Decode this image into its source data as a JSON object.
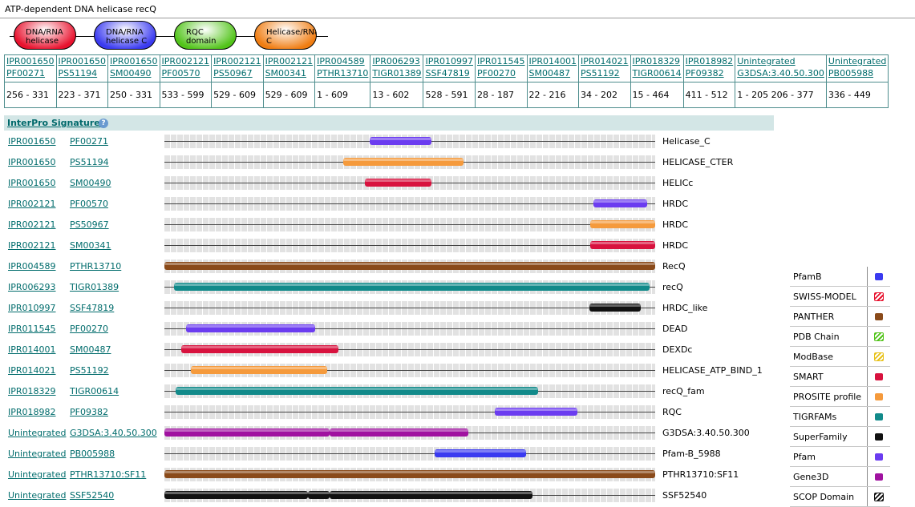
{
  "title": "ATP-dependent DNA helicase recQ",
  "domains": [
    {
      "label": "DNA/RNA helicase",
      "color": "#e8122e"
    },
    {
      "label": "DNA/RNA helicase C",
      "color": "#3a3af0"
    },
    {
      "label": "RQC domain",
      "color": "#52c41a"
    },
    {
      "label": "Helicase/RNaseD C",
      "color": "#f07d12"
    }
  ],
  "table": [
    {
      "ipr": "IPR001650",
      "acc": "PF00271",
      "pos": "256 - 331"
    },
    {
      "ipr": "IPR001650",
      "acc": "PS51194",
      "pos": "223 - 371"
    },
    {
      "ipr": "IPR001650",
      "acc": "SM00490",
      "pos": "250 - 331"
    },
    {
      "ipr": "IPR002121",
      "acc": "PF00570",
      "pos": "533 - 599"
    },
    {
      "ipr": "IPR002121",
      "acc": "PS50967",
      "pos": "529 - 609"
    },
    {
      "ipr": "IPR002121",
      "acc": "SM00341",
      "pos": "529 - 609"
    },
    {
      "ipr": "IPR004589",
      "acc": "PTHR13710",
      "pos": "1 - 609"
    },
    {
      "ipr": "IPR006293",
      "acc": "TIGR01389",
      "pos": "13 - 602"
    },
    {
      "ipr": "IPR010997",
      "acc": "SSF47819",
      "pos": "528 - 591"
    },
    {
      "ipr": "IPR011545",
      "acc": "PF00270",
      "pos": "28 - 187"
    },
    {
      "ipr": "IPR014001",
      "acc": "SM00487",
      "pos": "22 - 216"
    },
    {
      "ipr": "IPR014021",
      "acc": "PS51192",
      "pos": "34 - 202"
    },
    {
      "ipr": "IPR018329",
      "acc": "TIGR00614",
      "pos": "15 - 464"
    },
    {
      "ipr": "IPR018982",
      "acc": "PF09382",
      "pos": "411 - 512"
    },
    {
      "ipr": "Unintegrated",
      "acc": "G3DSA:3.40.50.300",
      "pos": "1 - 205 206 - 377"
    },
    {
      "ipr": "Unintegrated",
      "acc": "PB005988",
      "pos": "336 - 449"
    }
  ],
  "signatures_header": "InterPro Signatures",
  "help_icon": "?",
  "protein_length": 609,
  "signatures": [
    {
      "ipr": "IPR001650",
      "acc": "PF00271",
      "name": "Helicase_C",
      "color": "#6b3cf0",
      "segments": [
        [
          256,
          331
        ]
      ]
    },
    {
      "ipr": "IPR001650",
      "acc": "PS51194",
      "name": "HELICASE_CTER",
      "color": "#f59a3c",
      "segments": [
        [
          223,
          371
        ]
      ]
    },
    {
      "ipr": "IPR001650",
      "acc": "SM00490",
      "name": "HELICc",
      "color": "#d8123e",
      "segments": [
        [
          250,
          331
        ]
      ]
    },
    {
      "ipr": "IPR002121",
      "acc": "PF00570",
      "name": "HRDC",
      "color": "#6b3cf0",
      "segments": [
        [
          533,
          599
        ]
      ]
    },
    {
      "ipr": "IPR002121",
      "acc": "PS50967",
      "name": "HRDC",
      "color": "#f59a3c",
      "segments": [
        [
          529,
          609
        ]
      ]
    },
    {
      "ipr": "IPR002121",
      "acc": "SM00341",
      "name": "HRDC",
      "color": "#d8123e",
      "segments": [
        [
          529,
          609
        ]
      ]
    },
    {
      "ipr": "IPR004589",
      "acc": "PTHR13710",
      "name": "RecQ",
      "color": "#8a4a1a",
      "segments": [
        [
          1,
          609
        ]
      ]
    },
    {
      "ipr": "IPR006293",
      "acc": "TIGR01389",
      "name": "recQ",
      "color": "#128a8a",
      "segments": [
        [
          13,
          602
        ]
      ]
    },
    {
      "ipr": "IPR010997",
      "acc": "SSF47819",
      "name": "HRDC_like",
      "color": "#111111",
      "segments": [
        [
          528,
          591
        ]
      ]
    },
    {
      "ipr": "IPR011545",
      "acc": "PF00270",
      "name": "DEAD",
      "color": "#6b3cf0",
      "segments": [
        [
          28,
          187
        ]
      ]
    },
    {
      "ipr": "IPR014001",
      "acc": "SM00487",
      "name": "DEXDc",
      "color": "#d8123e",
      "segments": [
        [
          22,
          216
        ]
      ]
    },
    {
      "ipr": "IPR014021",
      "acc": "PS51192",
      "name": "HELICASE_ATP_BIND_1",
      "color": "#f59a3c",
      "segments": [
        [
          34,
          202
        ]
      ]
    },
    {
      "ipr": "IPR018329",
      "acc": "TIGR00614",
      "name": "recQ_fam",
      "color": "#128a8a",
      "segments": [
        [
          15,
          464
        ]
      ]
    },
    {
      "ipr": "IPR018982",
      "acc": "PF09382",
      "name": "RQC",
      "color": "#6b3cf0",
      "segments": [
        [
          411,
          512
        ]
      ]
    },
    {
      "ipr": "Unintegrated",
      "acc": "G3DSA:3.40.50.300",
      "name": "G3DSA:3.40.50.300",
      "color": "#a012a0",
      "segments": [
        [
          1,
          205
        ],
        [
          206,
          377
        ]
      ]
    },
    {
      "ipr": "Unintegrated",
      "acc": "PB005988",
      "name": "Pfam-B_5988",
      "color": "#3a3af0",
      "segments": [
        [
          336,
          449
        ]
      ]
    },
    {
      "ipr": "Unintegrated",
      "acc": "PTHR13710:SF11",
      "name": "PTHR13710:SF11",
      "color": "#8a4a1a",
      "segments": [
        [
          1,
          609
        ]
      ]
    },
    {
      "ipr": "Unintegrated",
      "acc": "SSF52540",
      "name": "SSF52540",
      "color": "#111111",
      "segments": [
        [
          1,
          178
        ],
        [
          179,
          205
        ],
        [
          206,
          457
        ]
      ]
    }
  ],
  "legend": [
    {
      "label": "PfamB",
      "color": "#3a3af0",
      "style": "solid"
    },
    {
      "label": "SWISS-MODEL",
      "color": "#e8122e",
      "style": "hatched"
    },
    {
      "label": "PANTHER",
      "color": "#8a4a1a",
      "style": "solid"
    },
    {
      "label": "PDB Chain",
      "color": "#52c41a",
      "style": "hatched"
    },
    {
      "label": "ModBase",
      "color": "#e8c21a",
      "style": "hatched"
    },
    {
      "label": "SMART",
      "color": "#d8123e",
      "style": "solid"
    },
    {
      "label": "PROSITE profile",
      "color": "#f59a3c",
      "style": "solid"
    },
    {
      "label": "TIGRFAMs",
      "color": "#128a8a",
      "style": "solid"
    },
    {
      "label": "SuperFamily",
      "color": "#111111",
      "style": "solid"
    },
    {
      "label": "Pfam",
      "color": "#6b3cf0",
      "style": "solid"
    },
    {
      "label": "Gene3D",
      "color": "#a012a0",
      "style": "solid"
    },
    {
      "label": "SCOP Domain",
      "color": "#111111",
      "style": "hatched"
    }
  ]
}
